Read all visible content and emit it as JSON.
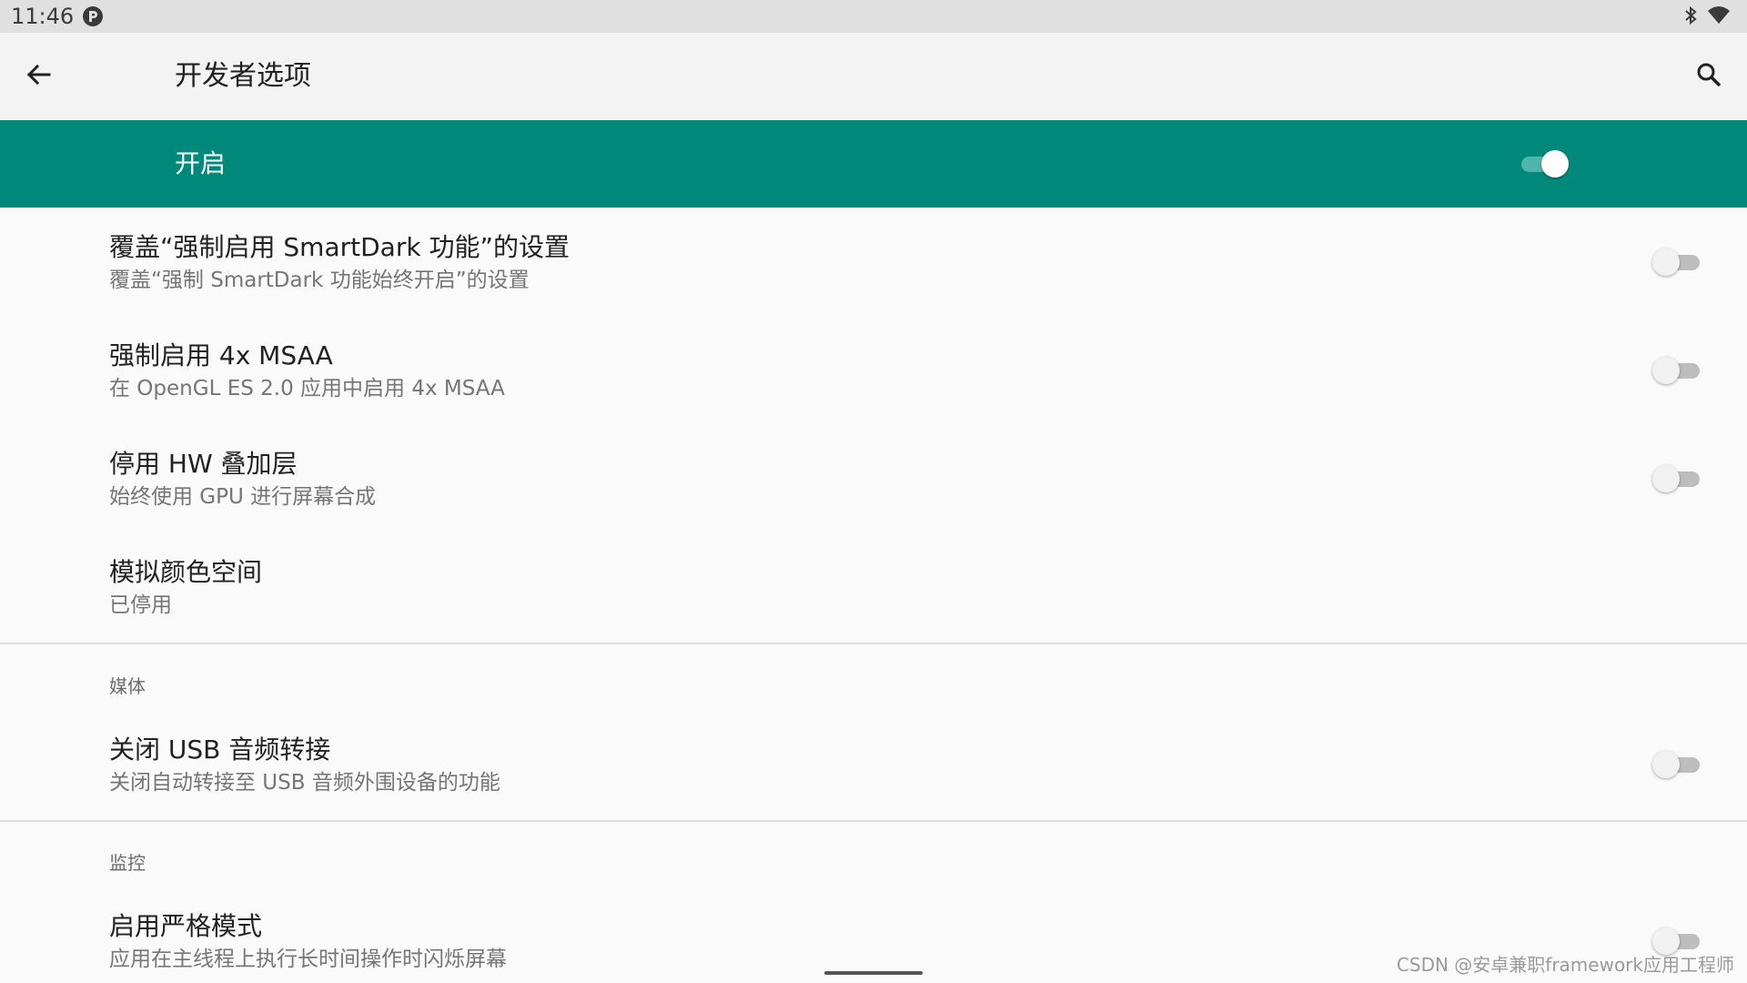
{
  "status_bar": {
    "time": "11:46",
    "app_icon": "p-circle-icon",
    "icons": [
      "bluetooth-icon",
      "wifi-icon"
    ]
  },
  "toolbar": {
    "back_icon": "arrow-left-icon",
    "title": "开发者选项",
    "search_icon": "search-icon"
  },
  "master_switch": {
    "label": "开启",
    "checked": true,
    "color": "#00897b"
  },
  "sections": {
    "drawing": {
      "items": [
        {
          "title": "覆盖“强制启用 SmartDark 功能”的设置",
          "summary": "覆盖“强制 SmartDark 功能始终开启”的设置",
          "checked": false
        },
        {
          "title": "强制启用 4x MSAA",
          "summary": "在 OpenGL ES 2.0 应用中启用 4x MSAA",
          "checked": false
        },
        {
          "title": "停用 HW 叠加层",
          "summary": "始终使用 GPU 进行屏幕合成",
          "checked": false
        },
        {
          "title": "模拟颜色空间",
          "summary": "已停用"
        }
      ]
    },
    "media": {
      "header": "媒体",
      "items": [
        {
          "title": "关闭 USB 音频转接",
          "summary": "关闭自动转接至 USB 音频外围设备的功能",
          "checked": false
        }
      ]
    },
    "monitoring": {
      "header": "监控",
      "items": [
        {
          "title": "启用严格模式",
          "summary": "应用在主线程上执行长时间操作时闪烁屏幕",
          "checked": false
        }
      ]
    }
  },
  "watermark": "CSDN @安卓兼职framework应用工程师"
}
